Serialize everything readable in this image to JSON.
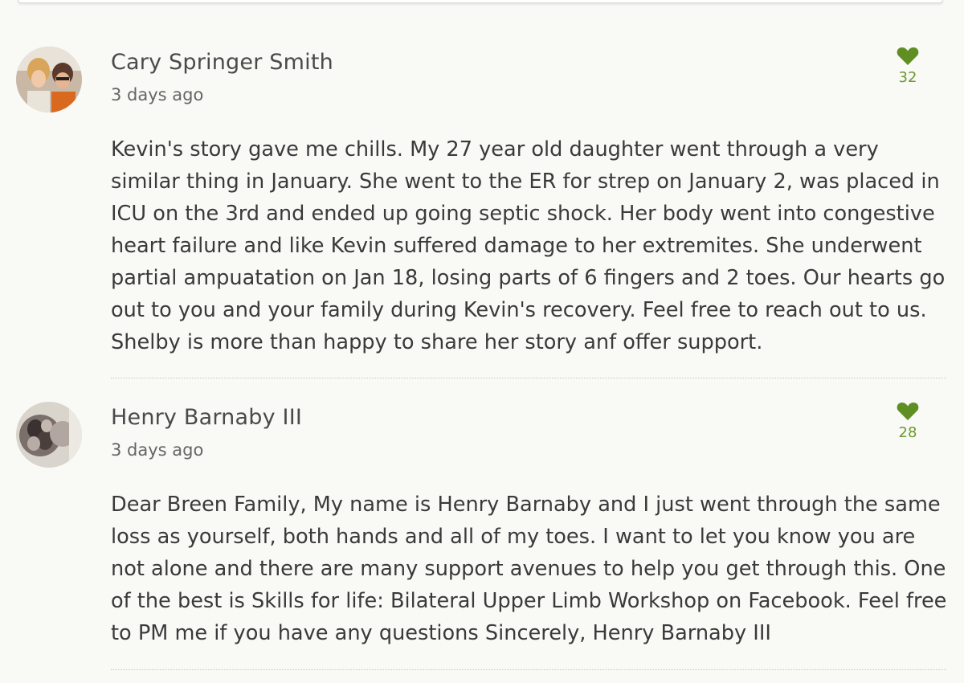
{
  "comments": [
    {
      "author": "Cary Springer Smith",
      "timestamp": "3 days ago",
      "likes": "32",
      "body": "Kevin's story gave me chills. My 27 year old daughter went through a very similar thing in January. She went to the ER for strep on January 2, was placed in ICU on the 3rd and ended up going septic shock. Her body went into congestive heart failure and like Kevin suffered damage to her extremites. She underwent partial ampuatation on Jan 18, losing parts of 6 fingers and 2 toes. Our hearts go out to you and your family during Kevin's recovery. Feel free to reach out to us. Shelby is more than happy to share her story anf offer support."
    },
    {
      "author": "Henry Barnaby III",
      "timestamp": "3 days ago",
      "likes": "28",
      "body": "Dear Breen Family, My name is Henry Barnaby and I just went through the same loss as yourself, both hands and all of my toes. I want to let you know you are not alone and there are many support avenues to help you get through this. One of the best is Skills for life: Bilateral Upper Limb Workshop on Facebook. Feel free to PM me if you have any questions Sincerely, Henry Barnaby III"
    }
  ],
  "colors": {
    "like_accent": "#5f8f22",
    "background": "#f9f9f6"
  },
  "icons": {
    "like": "heart-icon"
  }
}
